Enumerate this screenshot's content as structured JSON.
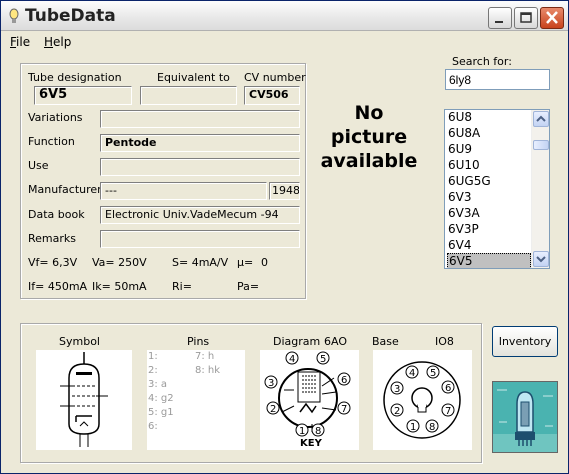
{
  "window": {
    "title": "TubeData"
  },
  "menu": {
    "file": "File",
    "help": "Help"
  },
  "details": {
    "designation_label": "Tube designation",
    "equivalent_label": "Equivalent to",
    "cv_label": "CV number",
    "designation": "6V5",
    "equivalent": "",
    "cv": "CV506",
    "variations_label": "Variations",
    "variations": "",
    "function_label": "Function",
    "function": "Pentode",
    "use_label": "Use",
    "use": "",
    "manufacturer_label": "Manufacturer",
    "manufacturer": "---",
    "year": "1948",
    "databook_label": "Data book",
    "databook": "Electronic Univ.VadeMecum -94",
    "remarks_label": "Remarks",
    "remarks": ""
  },
  "params": {
    "vf": "Vf= 6,3V",
    "va": "Va= 250V",
    "s": "S= 4mA/V",
    "mu": "µ=",
    "mu_val": "0",
    "if": "If= 450mA",
    "ik": "Ik= 50mA",
    "ri": "Ri=",
    "pa": "Pa="
  },
  "picture": {
    "line1": "No",
    "line2": "picture",
    "line3": "available"
  },
  "search": {
    "label": "Search for:",
    "value": "6ly8"
  },
  "tube_list": {
    "items": [
      "6U8",
      "6U8A",
      "6U9",
      "6U10",
      "6UG5G",
      "6V3",
      "6V3A",
      "6V3P",
      "6V4",
      "6V5"
    ],
    "selected": "6V5"
  },
  "bottom": {
    "symbol_label": "Symbol",
    "pins_label": "Pins",
    "diagram_label": "Diagram",
    "diagram_code": "6AO",
    "base_label": "Base",
    "base_code": "IO8",
    "key_label": "KEY",
    "pins": [
      "1:",
      "2:",
      "3: a",
      "4: g2",
      "5: g1",
      "6:",
      "7: h",
      "8: hk"
    ],
    "diagram_pin_numbers": [
      "1",
      "2",
      "3",
      "4",
      "5",
      "6",
      "7",
      "8"
    ],
    "base_pin_numbers": [
      "1",
      "2",
      "3",
      "4",
      "5",
      "6",
      "7",
      "8"
    ]
  },
  "inventory": {
    "label": "Inventory"
  }
}
